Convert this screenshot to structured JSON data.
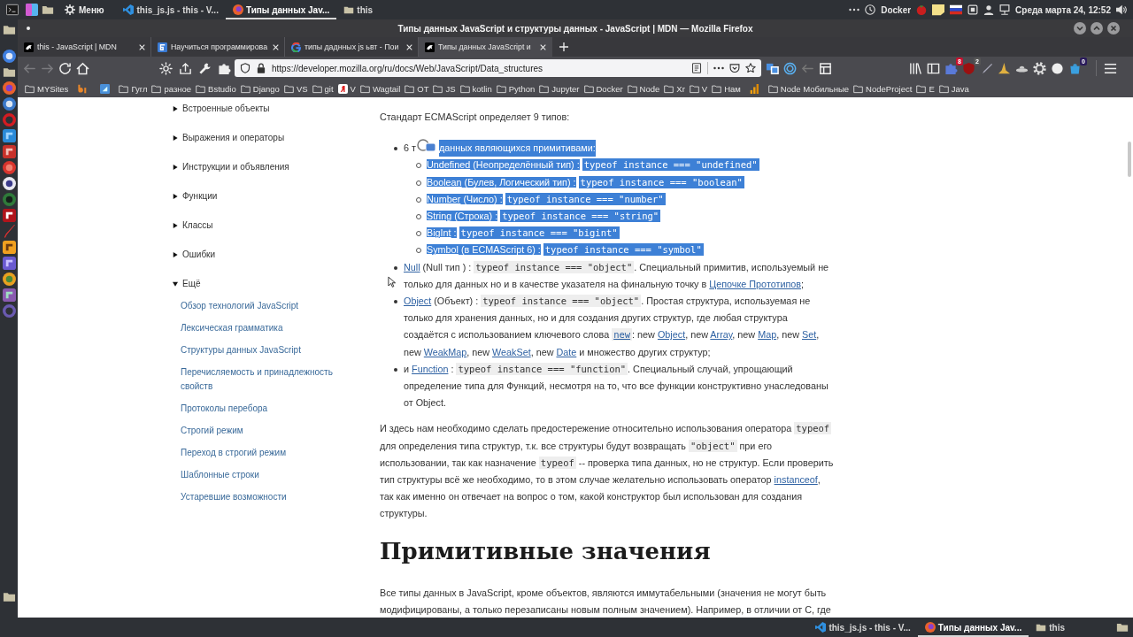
{
  "top_panel": {
    "menu_label": "Меню",
    "tasks": [
      {
        "kind": "editor",
        "label": "this_js.js - this - V...",
        "selected": false
      },
      {
        "kind": "browser",
        "label": "Типы данных Jav...",
        "selected": true
      },
      {
        "kind": "folder",
        "label": "this",
        "selected": false
      }
    ],
    "tray_label": "Docker",
    "clock": "Среда марта 24, 12:52"
  },
  "window": {
    "title": "Типы данных JavaScript и структуры данных - JavaScript | MDN — Mozilla Firefox"
  },
  "tabs": [
    {
      "kind": "mdn",
      "title": "this - JavaScript | MDN",
      "selected": false
    },
    {
      "kind": "tile",
      "title": "Научиться программирова",
      "selected": false
    },
    {
      "kind": "google",
      "title": "типы даднных js ьвт - Пои",
      "selected": false
    },
    {
      "kind": "mdn",
      "title": "Типы данных JavaScript и",
      "selected": true
    }
  ],
  "navigation": {
    "back": {
      "disabled": true
    },
    "forward": {
      "disabled": true
    }
  },
  "url_bar": {
    "value": "https://developer.mozilla.org/ru/docs/Web/JavaScript/Data_structures"
  },
  "toolbar_badges": [
    "8",
    "2",
    "0"
  ],
  "bookmarks": [
    {
      "kind": "folder",
      "label": "MYSites"
    },
    {
      "kind": "logo"
    },
    {
      "kind": "tile"
    },
    {
      "kind": "folder",
      "label": "Гугл"
    },
    {
      "kind": "folder",
      "label": "разное"
    },
    {
      "kind": "folder",
      "label": "Bstudio"
    },
    {
      "kind": "folder",
      "label": "Django"
    },
    {
      "kind": "folder",
      "label": "VS"
    },
    {
      "kind": "folder",
      "label": "git"
    },
    {
      "kind": "yandex",
      "label": "V"
    },
    {
      "kind": "folder",
      "label": "Wagtail"
    },
    {
      "kind": "folder",
      "label": "OT"
    },
    {
      "kind": "folder",
      "label": "JS"
    },
    {
      "kind": "folder",
      "label": "kotlin"
    },
    {
      "kind": "folder",
      "label": "Python"
    },
    {
      "kind": "folder",
      "label": "Jupyter"
    },
    {
      "kind": "folder",
      "label": "Docker"
    },
    {
      "kind": "folder",
      "label": "Node"
    },
    {
      "kind": "folder",
      "label": "Xr"
    },
    {
      "kind": "folder",
      "label": "V"
    },
    {
      "kind": "folder",
      "label": "Нам"
    },
    {
      "kind": "chart"
    },
    {
      "kind": "folder",
      "label": "Node Мобильные"
    },
    {
      "kind": "folder",
      "label": "NodeProject"
    },
    {
      "kind": "folder",
      "label": "E"
    },
    {
      "kind": "folder",
      "label": "Java"
    }
  ],
  "sidebar": {
    "items": [
      {
        "label": "Встроенные объекты",
        "expanded": false
      },
      {
        "label": "Выражения и операторы",
        "expanded": false
      },
      {
        "label": "Инструкции и объявления",
        "expanded": false
      },
      {
        "label": "Функции",
        "expanded": false
      },
      {
        "label": "Классы",
        "expanded": false
      },
      {
        "label": "Ошибки",
        "expanded": false
      },
      {
        "label": "Ещё",
        "expanded": true,
        "children": [
          {
            "label": "Обзор технологий JavaScript"
          },
          {
            "label": "Лексическая грамматика"
          },
          {
            "label": "Структуры данных JavaScript"
          },
          {
            "label": "Перечисляемость и принадлежность свойств"
          },
          {
            "label": "Протоколы перебора"
          },
          {
            "label": "Строгий режим"
          },
          {
            "label": "Переход в строгий режим"
          },
          {
            "label": "Шаблонные строки"
          },
          {
            "label": "Устаревшие возможности"
          }
        ]
      }
    ]
  },
  "article": {
    "intro": "Стандарт ECMAScript определяет 9 типов:",
    "types": {
      "lead": "6 т",
      "text": "данных являющихся примитивами:",
      "highlighted": true,
      "primitives": [
        {
          "link": "Undefined",
          "text": "(Неопределённый тип) :",
          "code": "typeof instance === \"undefined\"",
          "highlighted": true
        },
        {
          "link": "Boolean",
          "text": "(Булев, Логический тип) :",
          "code": "typeof instance === \"boolean\"",
          "highlighted": true
        },
        {
          "link": "Number",
          "text": "(Число) :",
          "code": "typeof instance === \"number\"",
          "highlighted": true
        },
        {
          "link": "String",
          "text": "(Строка) :",
          "code": "typeof instance === \"string\"",
          "highlighted": true
        },
        {
          "link": "BigInt",
          "text": ":",
          "code": "typeof instance === \"bigint\"",
          "highlighted": true
        },
        {
          "link": "Symbol",
          "text": "(в ECMAScript 6) :",
          "code": "typeof instance === \"symbol\"",
          "highlighted": true
        }
      ]
    },
    "items": [
      {
        "segments": [
          {
            "kind": "link",
            "text": "Null"
          },
          {
            "kind": "text",
            "text": " (Null тип ) : "
          },
          {
            "kind": "code",
            "text": "typeof instance === \"object\""
          },
          {
            "kind": "text",
            "text": ". Специальный примитив, используемый не только для данных но и в качестве указателя на финальную точку в "
          },
          {
            "kind": "link",
            "text": "Цепочке Прототипов"
          },
          {
            "kind": "text",
            "text": ";"
          }
        ]
      },
      {
        "segments": [
          {
            "kind": "link",
            "text": "Object"
          },
          {
            "kind": "text",
            "text": " (Объект) : "
          },
          {
            "kind": "code",
            "text": "typeof instance === \"object\""
          },
          {
            "kind": "text",
            "text": ". Простая структура, используемая не только для хранения данных, но и для создания других структур, где любая структура создаётся с использованием ключевого слова "
          },
          {
            "kind": "code_link",
            "text": "new"
          },
          {
            "kind": "text",
            "text": ": new "
          },
          {
            "kind": "link",
            "text": "Object"
          },
          {
            "kind": "text",
            "text": ", new "
          },
          {
            "kind": "link",
            "text": "Array"
          },
          {
            "kind": "text",
            "text": ", new "
          },
          {
            "kind": "link",
            "text": "Map"
          },
          {
            "kind": "text",
            "text": ", new "
          },
          {
            "kind": "link",
            "text": "Set"
          },
          {
            "kind": "text",
            "text": ", new "
          },
          {
            "kind": "link",
            "text": "WeakMap"
          },
          {
            "kind": "text",
            "text": ", new "
          },
          {
            "kind": "link",
            "text": "WeakSet"
          },
          {
            "kind": "text",
            "text": ", new "
          },
          {
            "kind": "link",
            "text": "Date"
          },
          {
            "kind": "text",
            "text": " и множество других структур;"
          }
        ]
      },
      {
        "segments": [
          {
            "kind": "text",
            "text": "и "
          },
          {
            "kind": "link",
            "text": "Function"
          },
          {
            "kind": "text",
            "text": " : "
          },
          {
            "kind": "code",
            "text": "typeof instance === \"function\""
          },
          {
            "kind": "text",
            "text": ". Специальный случай, упрощающий определение типа для Функций, несмотря на то, что все функции конструктивно унаследованы от Object."
          }
        ]
      }
    ],
    "note": {
      "segments": [
        {
          "kind": "text",
          "text": "И здесь нам необходимо сделать предостережение относительно использования оператора "
        },
        {
          "kind": "code",
          "text": "typeof"
        },
        {
          "kind": "text",
          "text": " для определения типа структур, т.к. все структуры будут возвращать "
        },
        {
          "kind": "code",
          "text": "\"object\""
        },
        {
          "kind": "text",
          "text": " при его использовании, так как назначение "
        },
        {
          "kind": "code",
          "text": "typeof"
        },
        {
          "kind": "text",
          "text": " -- проверка типа данных, но не структур. Если проверить тип структуры всё же необходимо, то в этом случае желательно использовать оператор "
        },
        {
          "kind": "link",
          "text": "instanceof"
        },
        {
          "kind": "text",
          "text": ", так как именно он отвечает на вопрос о том, какой конструктор был использован для создания структуры."
        }
      ]
    },
    "heading": "Примитивные значения",
    "paragraph": "Все типы данных в JavaScript, кроме объектов, являются иммутабельными (значения не могут быть модифицированы, а только перезаписаны новым полным значением). Например, в отличии от C, где"
  },
  "bottom_panel": {
    "tasks": [
      {
        "kind": "editor",
        "label": "this_js.js - this - V...",
        "selected": false
      },
      {
        "kind": "browser",
        "label": "Типы данных Jav...",
        "selected": true
      },
      {
        "kind": "folder",
        "label": "this",
        "selected": false
      }
    ]
  }
}
